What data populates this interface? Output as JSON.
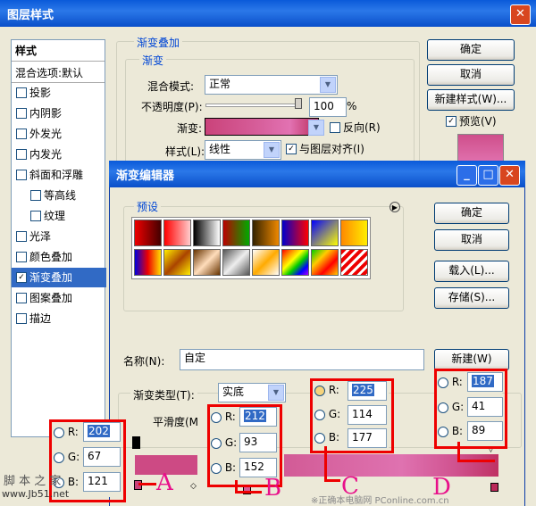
{
  "layer_style": {
    "title": "图层样式",
    "styles_header": "样式",
    "blend_options": "混合选项:默认",
    "items": [
      {
        "label": "投影",
        "checked": false
      },
      {
        "label": "内阴影",
        "checked": false
      },
      {
        "label": "外发光",
        "checked": false
      },
      {
        "label": "内发光",
        "checked": false
      },
      {
        "label": "斜面和浮雕",
        "checked": false
      },
      {
        "label": "等高线",
        "checked": false
      },
      {
        "label": "纹理",
        "checked": false
      },
      {
        "label": "光泽",
        "checked": false
      },
      {
        "label": "颜色叠加",
        "checked": false
      },
      {
        "label": "渐变叠加",
        "checked": true
      },
      {
        "label": "图案叠加",
        "checked": false
      },
      {
        "label": "描边",
        "checked": false
      }
    ],
    "section_title": "渐变叠加",
    "sub_title": "渐变",
    "blend_mode_label": "混合模式:",
    "blend_mode_value": "正常",
    "opacity_label": "不透明度(P):",
    "opacity_value": "100",
    "opacity_unit": "%",
    "gradient_label": "渐变:",
    "reverse_label": "反向(R)",
    "style_label": "样式(L):",
    "style_value": "线性",
    "align_label": "与图层对齐(I)",
    "ok": "确定",
    "cancel": "取消",
    "new_style": "新建样式(W)...",
    "preview": "预览(V)"
  },
  "gradient_editor": {
    "title": "渐变编辑器",
    "presets_label": "预设",
    "ok": "确定",
    "cancel": "取消",
    "load": "载入(L)...",
    "save": "存储(S)...",
    "name_label": "名称(N):",
    "name_value": "自定",
    "new_button": "新建(W)",
    "type_label": "渐变类型(T):",
    "type_value": "实底",
    "smooth_label": "平滑度(M",
    "colors": {
      "pink": "#c8467f",
      "light": "#e170b1",
      "dark": "#bb2959"
    }
  },
  "annotations": {
    "a": {
      "letter": "A",
      "R": "202",
      "G": "67",
      "B": "121"
    },
    "b": {
      "letter": "B",
      "R": "212",
      "G": "93",
      "B": "152"
    },
    "c": {
      "letter": "C",
      "R": "225",
      "G": "114",
      "B": "177"
    },
    "d": {
      "letter": "D",
      "R": "187",
      "G": "41",
      "B": "89"
    },
    "r_label": "R:",
    "g_label": "G:",
    "b_label": "B:"
  },
  "watermarks": {
    "site_cn": "脚 本 之 家",
    "site_url": "www.Jb51.net",
    "bottom_text": "※正确本电脑网 PConline.com.cn"
  }
}
